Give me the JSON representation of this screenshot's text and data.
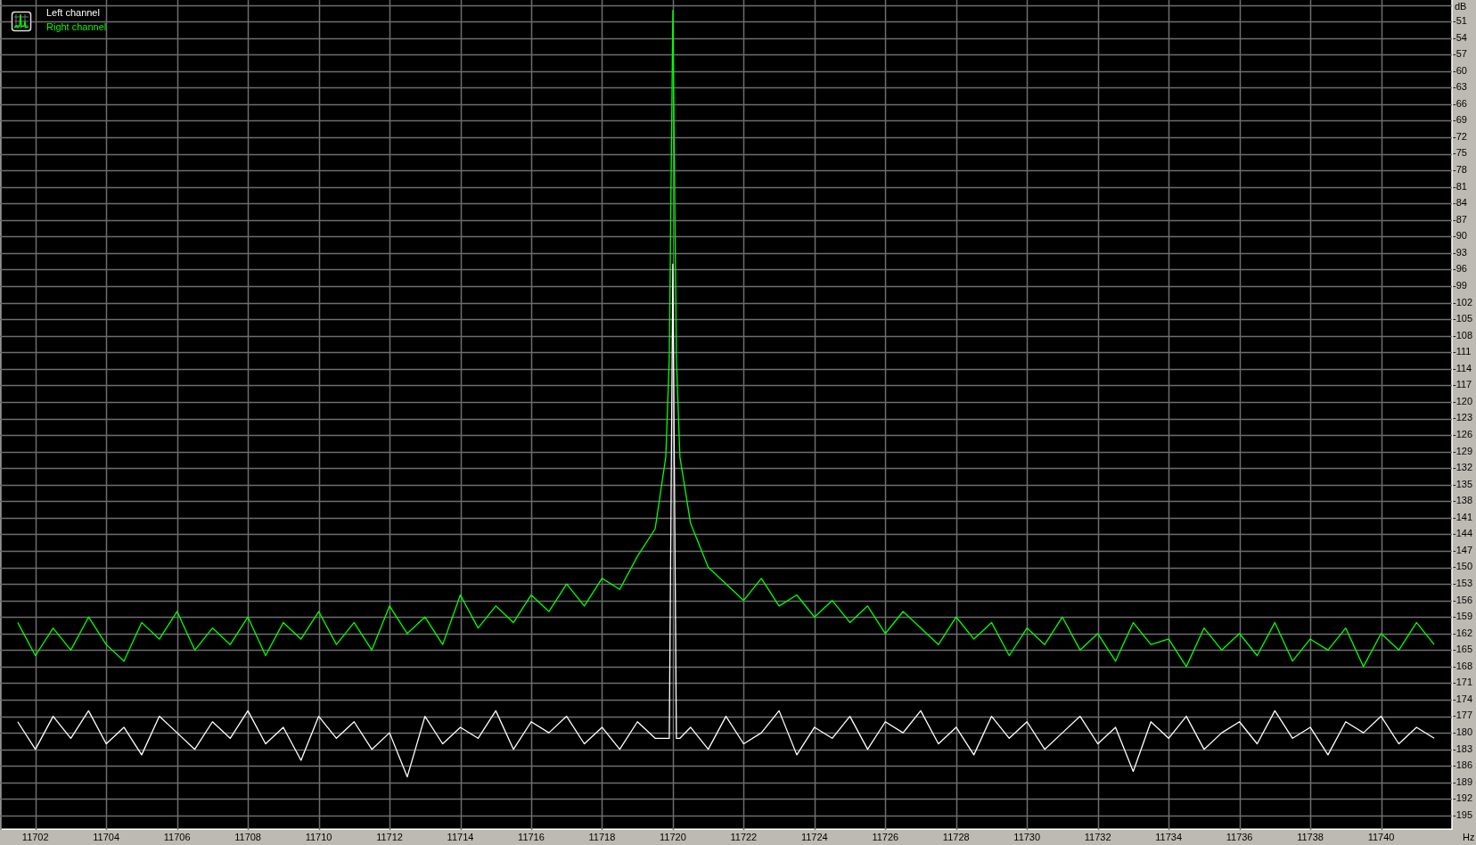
{
  "chart_data": {
    "type": "line",
    "grid": true,
    "xlabel": "Hz",
    "ylabel": "dB",
    "xlim": [
      11701.0,
      11742.0
    ],
    "ylim": [
      -197.6,
      -47.1
    ],
    "xticks": [
      11702,
      11704,
      11706,
      11708,
      11710,
      11712,
      11714,
      11716,
      11718,
      11720,
      11722,
      11724,
      11726,
      11728,
      11730,
      11732,
      11734,
      11736,
      11738,
      11740
    ],
    "yticks": [
      -51,
      -54,
      -57,
      -60,
      -63,
      -66,
      -69,
      -72,
      -75,
      -78,
      -81,
      -84,
      -87,
      -90,
      -93,
      -96,
      -99,
      -102,
      -105,
      -108,
      -111,
      -114,
      -117,
      -120,
      -123,
      -126,
      -129,
      -132,
      -135,
      -138,
      -141,
      -144,
      -147,
      -150,
      -153,
      -156,
      -159,
      -162,
      -165,
      -168,
      -171,
      -174,
      -177,
      -180,
      -183,
      -186,
      -189,
      -192,
      -195
    ],
    "x": [
      11701.5,
      11702,
      11702.5,
      11703,
      11703.5,
      11704,
      11704.5,
      11705,
      11705.5,
      11706,
      11706.5,
      11707,
      11707.5,
      11708,
      11708.5,
      11709,
      11709.5,
      11710,
      11710.5,
      11711,
      11711.5,
      11712,
      11712.5,
      11713,
      11713.5,
      11714,
      11714.5,
      11715,
      11715.5,
      11716,
      11716.5,
      11717,
      11717.5,
      11718,
      11718.5,
      11719,
      11719.5,
      11719.8,
      11719.9,
      11720,
      11720.1,
      11720.2,
      11720.5,
      11721,
      11721.5,
      11722,
      11722.5,
      11723,
      11723.5,
      11724,
      11724.5,
      11725,
      11725.5,
      11726,
      11726.5,
      11727,
      11727.5,
      11728,
      11728.5,
      11729,
      11729.5,
      11730,
      11730.5,
      11731,
      11731.5,
      11732,
      11732.5,
      11733,
      11733.5,
      11734,
      11734.5,
      11735,
      11735.5,
      11736,
      11736.5,
      11737,
      11737.5,
      11738,
      11738.5,
      11739,
      11739.5,
      11740,
      11740.5,
      11741,
      11741.5
    ],
    "series": [
      {
        "name": "Left channel",
        "color": "#ffffff",
        "values": [
          -178,
          -183,
          -177,
          -181,
          -176,
          -182,
          -179,
          -184,
          -177,
          -180,
          -183,
          -178,
          -181,
          -176,
          -182,
          -179,
          -185,
          -177,
          -181,
          -178,
          -183,
          -180,
          -188,
          -177,
          -182,
          -179,
          -181,
          -176,
          -183,
          -178,
          -180,
          -177,
          -182,
          -179,
          -183,
          -178,
          -181,
          -181,
          -181,
          -95,
          -181,
          -181,
          -179,
          -183,
          -177,
          -182,
          -180,
          -176,
          -184,
          -179,
          -181,
          -177,
          -183,
          -178,
          -180,
          -176,
          -182,
          -179,
          -184,
          -177,
          -181,
          -178,
          -183,
          -180,
          -177,
          -182,
          -179,
          -187,
          -178,
          -181,
          -177,
          -183,
          -180,
          -178,
          -182,
          -176,
          -181,
          -179,
          -184,
          -178,
          -180,
          -177,
          -182,
          -179,
          -181
        ]
      },
      {
        "name": "Right channel",
        "color": "#00ff00",
        "values": [
          -160,
          -166,
          -161,
          -165,
          -159,
          -164,
          -167,
          -160,
          -163,
          -158,
          -165,
          -161,
          -164,
          -159,
          -166,
          -160,
          -163,
          -158,
          -164,
          -160,
          -165,
          -157,
          -162,
          -159,
          -164,
          -155,
          -161,
          -157,
          -160,
          -155,
          -158,
          -153,
          -157,
          -152,
          -154,
          -148,
          -143,
          -130,
          -112,
          -49,
          -112,
          -130,
          -142,
          -150,
          -153,
          -156,
          -152,
          -157,
          -155,
          -159,
          -156,
          -160,
          -157,
          -162,
          -158,
          -161,
          -164,
          -159,
          -163,
          -160,
          -166,
          -161,
          -164,
          -159,
          -165,
          -162,
          -167,
          -160,
          -164,
          -163,
          -168,
          -161,
          -165,
          -162,
          -166,
          -160,
          -167,
          -163,
          -165,
          -161,
          -168,
          -162,
          -165,
          -160,
          -164
        ]
      }
    ]
  }
}
